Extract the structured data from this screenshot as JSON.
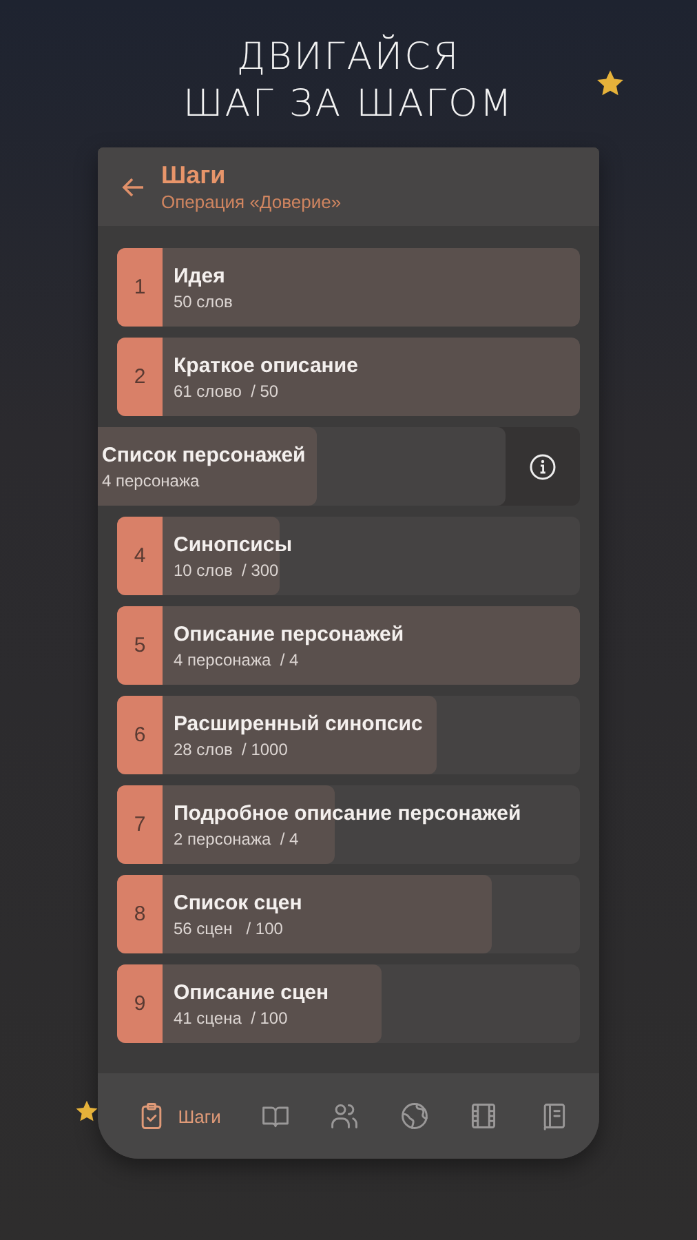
{
  "headline": [
    "ДВИГАЙСЯ",
    "ШАГ ЗА ШАГОМ"
  ],
  "header": {
    "title": "Шаги",
    "subtitle": "Операция «Доверие»"
  },
  "steps": [
    {
      "kind": "normal",
      "number": "1",
      "title": "Идея",
      "progress": "50 слов",
      "level": 1
    },
    {
      "kind": "normal",
      "number": "2",
      "title": "Краткое описание",
      "progress": "61 слово  / 50",
      "level": 1
    },
    {
      "kind": "swiped",
      "title": "Список персонажей",
      "progress": "4 персонажа",
      "level": 0.59
    },
    {
      "kind": "normal",
      "number": "4",
      "title": "Синопсисы",
      "progress": "10 слов  / 300",
      "level": 0.35
    },
    {
      "kind": "normal",
      "number": "5",
      "title": "Описание персонажей",
      "progress": "4 персонажа  / 4",
      "level": 1
    },
    {
      "kind": "normal",
      "number": "6",
      "title": "Расширенный синопсис",
      "progress": "28 слов  / 1000",
      "level": 0.69
    },
    {
      "kind": "normal",
      "number": "7",
      "title": "Подробное описание персонажей",
      "progress": "2 персонажа  / 4",
      "level": 0.47
    },
    {
      "kind": "normal",
      "number": "8",
      "title": "Список сцен",
      "progress": "56 сцен   / 100",
      "level": 0.81
    },
    {
      "kind": "normal",
      "number": "9",
      "title": "Описание сцен",
      "progress": "41 сцена  / 100",
      "level": 0.57
    }
  ],
  "nav": [
    {
      "label": "Шаги",
      "selected": true
    },
    {
      "selected": false
    },
    {
      "selected": false
    },
    {
      "selected": false
    },
    {
      "selected": false
    },
    {
      "selected": false
    }
  ]
}
